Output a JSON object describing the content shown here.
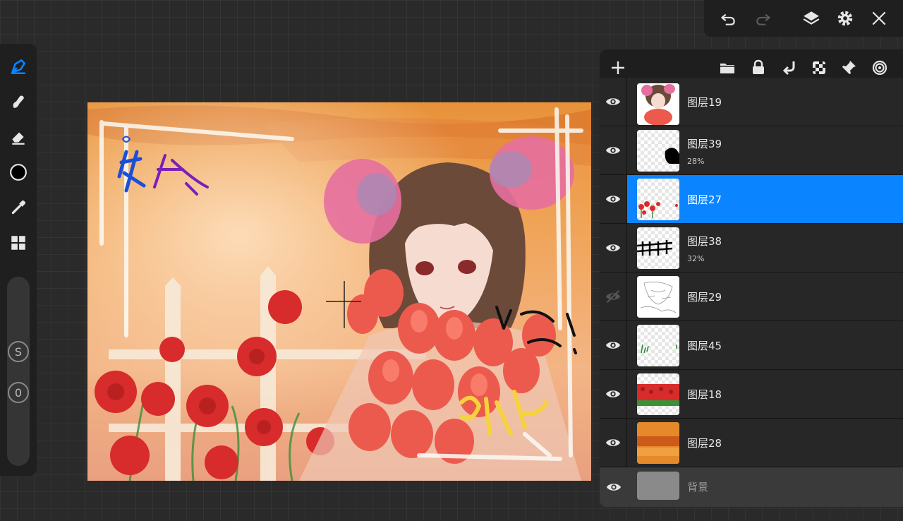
{
  "colors": {
    "accent": "#0a84ff",
    "toolbar_bg": "#1f1f1f",
    "panel_bg": "#1e1e1e",
    "current_color": "#000000"
  },
  "left_toolbar": {
    "tools": [
      "brush-icon",
      "smudge-icon",
      "eraser-icon",
      "color-swatch",
      "eyedropper-icon",
      "panels-icon"
    ],
    "active_tool": "brush-icon",
    "size_label": "S",
    "opacity_label": "0"
  },
  "top_bar": {
    "buttons": [
      "undo-icon",
      "redo-icon",
      "layers-icon",
      "settings-icon",
      "close-icon"
    ]
  },
  "layers_toolbar": {
    "buttons": [
      "add-layer-icon",
      "folder-icon",
      "lock-icon",
      "merge-down-icon",
      "transparency-lock-icon",
      "pin-icon",
      "layer-effects-icon"
    ]
  },
  "layers": [
    {
      "name": "图层19",
      "opacity": "",
      "visible": true,
      "selected": false
    },
    {
      "name": "图层39",
      "opacity": "28%",
      "visible": true,
      "selected": false
    },
    {
      "name": "图层27",
      "opacity": "",
      "visible": true,
      "selected": true
    },
    {
      "name": "图层38",
      "opacity": "32%",
      "visible": true,
      "selected": false
    },
    {
      "name": "图层29",
      "opacity": "",
      "visible": false,
      "selected": false
    },
    {
      "name": "图层45",
      "opacity": "",
      "visible": true,
      "selected": false
    },
    {
      "name": "图层18",
      "opacity": "",
      "visible": true,
      "selected": false
    },
    {
      "name": "图层28",
      "opacity": "",
      "visible": true,
      "selected": false
    },
    {
      "name": "背景",
      "opacity": "",
      "visible": true,
      "selected": false
    }
  ],
  "artwork": {
    "text_top_left": "依处",
    "text_right": "加油!",
    "text_bottom": "时光"
  }
}
